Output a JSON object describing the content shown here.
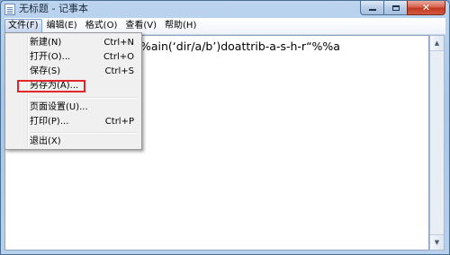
{
  "window": {
    "title": "无标题 - 记事本",
    "controls": {
      "minimize": "",
      "maximize": "",
      "close": "✕"
    }
  },
  "menubar": {
    "items": [
      {
        "label": "文件(F)"
      },
      {
        "label": "编辑(E)"
      },
      {
        "label": "格式(O)"
      },
      {
        "label": "查看(V)"
      },
      {
        "label": "帮助(H)"
      }
    ]
  },
  "file_menu": {
    "items": [
      {
        "label": "新建(N)",
        "shortcut": "Ctrl+N"
      },
      {
        "label": "打开(O)...",
        "shortcut": "Ctrl+O"
      },
      {
        "label": "保存(S)",
        "shortcut": "Ctrl+S"
      },
      {
        "label": "另存为(A)...",
        "shortcut": ""
      },
      {
        "label": "页面设置(U)...",
        "shortcut": ""
      },
      {
        "label": "打印(P)...",
        "shortcut": "Ctrl+P"
      },
      {
        "label": "退出(X)",
        "shortcut": ""
      }
    ],
    "highlighted_item": "另存为(A)...",
    "highlight_color": "#e0282b"
  },
  "editor": {
    "content": "%ain(‘dir/a/b’)doattrib-a-s-h-r“%%a"
  },
  "scrollbar": {
    "up_glyph": "▲",
    "down_glyph": "▼"
  }
}
